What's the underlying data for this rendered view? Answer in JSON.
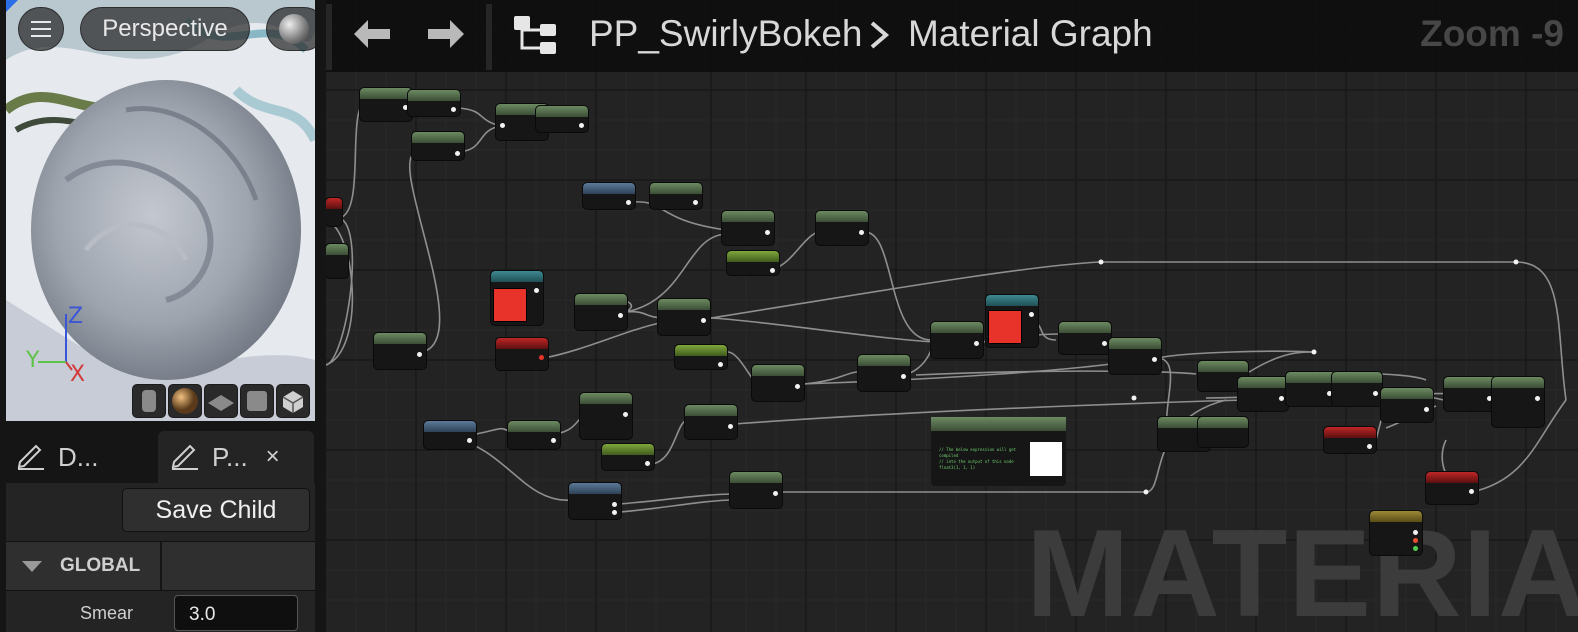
{
  "viewport": {
    "menu_icon": "hamburger-icon",
    "view_mode_label": "Perspective",
    "lit_icon": "lit-sphere-icon",
    "axis": {
      "z": "Z",
      "y": "Y",
      "x": "X"
    },
    "preview_shapes": [
      "cylinder-icon",
      "sphere-icon",
      "plane-icon",
      "cube-icon",
      "custom-mesh-icon"
    ]
  },
  "details_panel": {
    "tabs": [
      {
        "icon": "edit-icon",
        "label": "D..."
      },
      {
        "icon": "edit-icon",
        "label": "P...",
        "close_label": "×"
      }
    ],
    "save_child_label": "Save Child",
    "section_label": "GLOBAL",
    "params": [
      {
        "label": "Smear",
        "value": "3.0"
      }
    ]
  },
  "graph": {
    "header": {
      "back_icon": "arrow-left-icon",
      "forward_icon": "arrow-right-icon",
      "hierarchy_icon": "graph-hierarchy-icon",
      "breadcrumb": [
        "PP_SwirlyBokeh",
        "Material Graph"
      ],
      "zoom_label": "Zoom -9"
    },
    "watermark": "MATERIAL",
    "comment_code": "// The below expression will get compiled\n// into the output of this node\nfloat3(1, 1, 1)",
    "colors": {
      "node_green": "#6c8b62",
      "node_lime": "#7fa83c",
      "node_blue": "#5b7a99",
      "node_teal": "#3f8a93",
      "node_red": "#c02626",
      "node_gold": "#9c8a36",
      "swatch_red": "#e8332a",
      "background": "#232323"
    }
  }
}
